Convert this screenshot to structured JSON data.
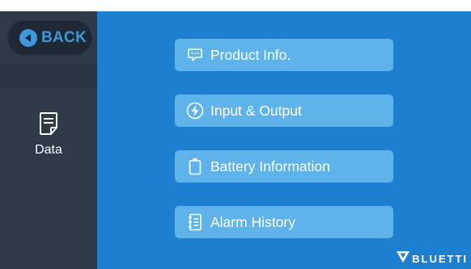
{
  "sidebar": {
    "back_label": "BACK",
    "nav_item_label": "Data"
  },
  "menu": {
    "items": [
      {
        "label": "Product Info.",
        "icon": "message-dots-icon"
      },
      {
        "label": "Input & Output",
        "icon": "lightning-icon"
      },
      {
        "label": "Battery Information",
        "icon": "battery-icon"
      },
      {
        "label": "Alarm History",
        "icon": "log-list-icon"
      }
    ]
  },
  "brand": {
    "name": "BLUETTI",
    "icon": "bluetti-logo-icon"
  },
  "colors": {
    "sidebar_bg": "#2f3a48",
    "main_bg": "#1d7fd0",
    "button_bg": "#5eb3ea",
    "accent": "#3e97d8"
  }
}
